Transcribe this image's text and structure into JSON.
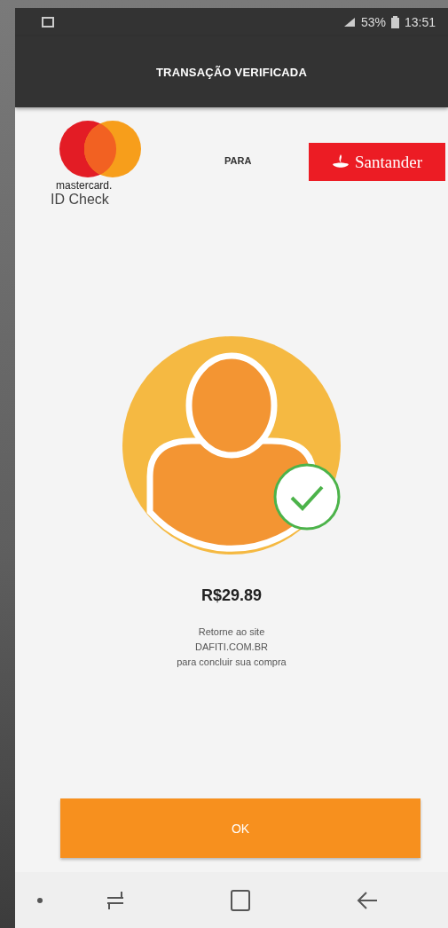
{
  "status_bar": {
    "battery": "53%",
    "time": "13:51"
  },
  "app_bar": {
    "title": "TRANSAÇÃO VERIFICADA"
  },
  "header": {
    "brand_line_1": "mastercard.",
    "brand_line_2": "ID Check",
    "connector": "PARA",
    "bank": "Santander"
  },
  "result": {
    "verified": true,
    "amount": "R$29.89",
    "message": [
      "Retorne ao site",
      "DAFITI.COM.BR",
      "para concluir sua compra"
    ]
  },
  "button": "OK"
}
